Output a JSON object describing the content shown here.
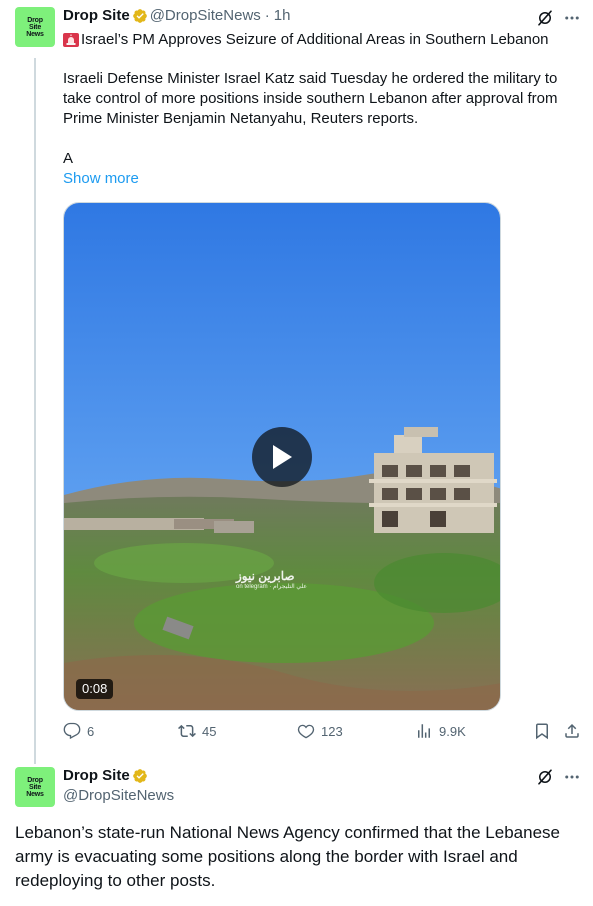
{
  "tweet1": {
    "author_name": "Drop Site",
    "author_handle": "@DropSiteNews",
    "separator": "·",
    "timestamp": "1h",
    "avatar_text": [
      "Drop",
      "Site",
      "News"
    ],
    "headline": "Israel’s PM Approves Seizure of Additional Areas in Southern Lebanon",
    "body": "Israeli Defense Minister Israel Katz said Tuesday he ordered the military to take control of more positions inside southern Lebanon after approval from Prime Minister Benjamin Netanyahu, Reuters reports.",
    "body_truncated": "A",
    "show_more": "Show more",
    "video": {
      "duration": "0:08",
      "watermark_title": "صابرين نيوز",
      "watermark_sub": "on telegram · علي التليجرام"
    },
    "metrics": {
      "replies": "6",
      "reposts": "45",
      "likes": "123",
      "views": "9.9K"
    }
  },
  "tweet2": {
    "author_name": "Drop Site",
    "author_handle": "@DropSiteNews",
    "avatar_text": [
      "Drop",
      "Site",
      "News"
    ],
    "body": "Lebanon’s state-run National News Agency confirmed that the Lebanese army is evacuating some positions along the border with Israel and redeploying to other posts."
  },
  "colors": {
    "avatar_bg": "#7ef07b",
    "link": "#1d9bf0",
    "verified_badge": "#e2b719",
    "muted_text": "#536471"
  },
  "icons": {
    "verified": "gold-verified-badge-icon",
    "grok": "grok-icon",
    "more": "more-options-icon",
    "siren": "siren-emoji-icon",
    "reply": "reply-icon",
    "repost": "repost-icon",
    "like": "like-icon",
    "views": "views-icon",
    "bookmark": "bookmark-icon",
    "share": "share-icon",
    "play": "play-icon"
  }
}
